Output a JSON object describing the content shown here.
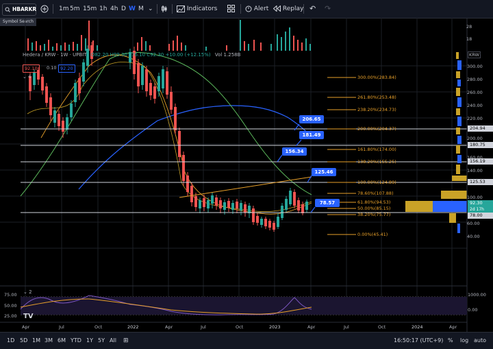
{
  "toolbar": {
    "symbol": "HBARKR",
    "add_symbol": "+",
    "intervals": [
      "1m",
      "5m",
      "15m",
      "1h",
      "4h",
      "D",
      "W",
      "M"
    ],
    "active_interval": "W",
    "chart_type_icon": "candles-icon",
    "indicators_label": "Indicators",
    "alert_label": "Alert",
    "replay_label": "Replay",
    "undo_icon": "undo-icon",
    "redo_icon": "redo-icon"
  },
  "symbol_search_label": "Symbol Search",
  "legend": {
    "title": "Hedera / KRW · 1W · UPBIT",
    "ohlc": "O82.20 H99.30 L76.10 C92.30 +10.00 (+12.15%)",
    "volume": "Vol 1.258B",
    "bid": "92.10",
    "spread": "0.10",
    "ask": "92.20",
    "indicator_count": "4"
  },
  "callouts": [
    "206.65",
    "181.49",
    "156.34",
    "125.46",
    "78.57"
  ],
  "fib_levels": [
    "300.00%(283.84)",
    "261.80%(253.48)",
    "238.20%(234.73)",
    "200.00%(204.37)",
    "161.80%(174.00)",
    "138.20%(155.25)",
    "100.00%(124.89)",
    "78.60%(107.88)",
    "61.80%(94.53)",
    "50.00%(85.15)",
    "38.20%(75.77)",
    "0.00%(45.41)"
  ],
  "price_axis": {
    "currency": "KRW",
    "ticks": [
      "300.00",
      "280.00",
      "260.00",
      "240.00",
      "220.00",
      "200.00",
      "180.00",
      "160.00",
      "140.00",
      "120.00",
      "100.00",
      "80.00",
      "60.00",
      "40.00"
    ],
    "volume_ticks": [
      "28",
      "18"
    ],
    "labels": {
      "l204": "204.94",
      "l180": "180.75",
      "l156": "156.19",
      "l125": "125.53",
      "last": "92.30",
      "countdown": "2d 17h",
      "l78": "78.00"
    }
  },
  "rsi": {
    "count": "2",
    "ticks": [
      "75.00",
      "50.00",
      "25.00"
    ],
    "right_ticks": [
      "1000.00",
      "0.00"
    ]
  },
  "time_axis": [
    "Apr",
    "Jul",
    "Oct",
    "2022",
    "Apr",
    "Jul",
    "Oct",
    "2023",
    "Apr",
    "Jul",
    "Oct",
    "2024",
    "Apr"
  ],
  "bottom": {
    "ranges": [
      "1D",
      "5D",
      "1M",
      "3M",
      "6M",
      "YTD",
      "1Y",
      "5Y",
      "All"
    ],
    "time": "16:50:17 (UTC+9)",
    "percent": "%",
    "log": "log",
    "auto": "auto"
  },
  "colors": {
    "up": "#26a69a",
    "down": "#ef5350",
    "accent": "#2962ff",
    "fib": "#e8a02a",
    "background": "#000000"
  }
}
